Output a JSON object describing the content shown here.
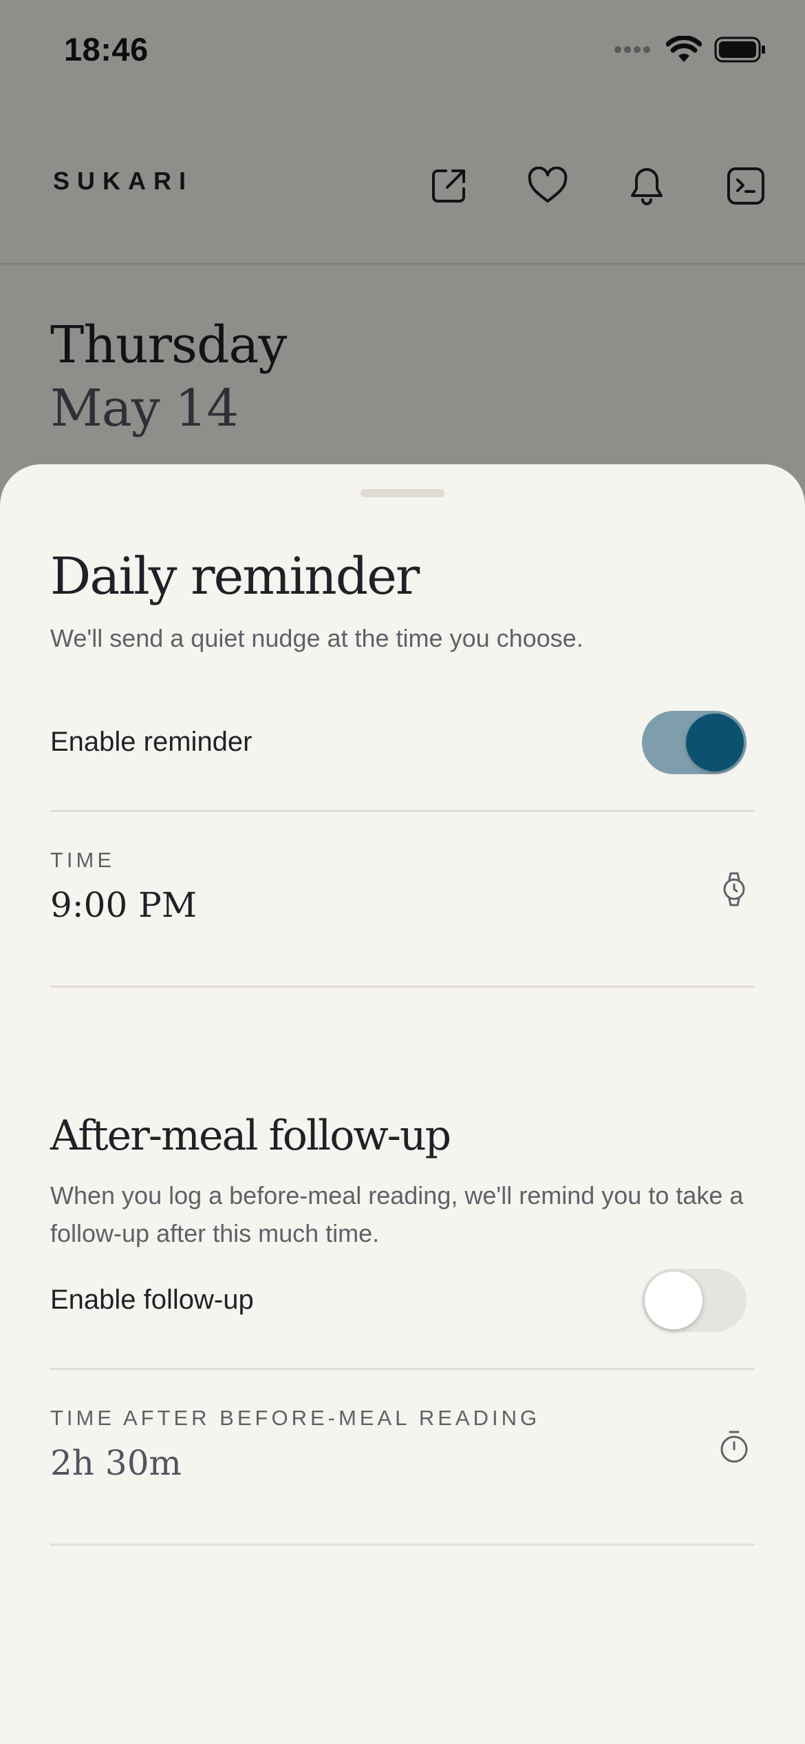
{
  "status_bar": {
    "time": "18:46"
  },
  "header": {
    "brand": "SUKARI",
    "icons": [
      "external-link-icon",
      "heart-icon",
      "bell-icon",
      "terminal-icon"
    ]
  },
  "background": {
    "day": "Thursday",
    "date": "May 14"
  },
  "sheet": {
    "title": "Daily reminder",
    "subtitle": "We'll send a quiet nudge at the time you choose.",
    "enable_reminder": {
      "label": "Enable reminder",
      "enabled": true
    },
    "time_field": {
      "caption": "TIME",
      "value": "9:00 PM",
      "icon": "watch-icon"
    },
    "follow_up": {
      "title": "After-meal follow-up",
      "description": "When you log a before-meal reading, we'll remind you to take a follow-up after this much time.",
      "enable": {
        "label": "Enable follow-up",
        "enabled": false
      },
      "interval_field": {
        "caption": "TIME AFTER BEFORE-MEAL READING",
        "value": "2h 30m",
        "icon": "timer-icon"
      }
    }
  },
  "colors": {
    "background": "#F6F4EF",
    "accent": "#0C5270",
    "toggle_on_track": "#7E9EAD",
    "text_primary": "#1E2226",
    "text_secondary": "#5D6268",
    "divider": "#E1DED7"
  }
}
